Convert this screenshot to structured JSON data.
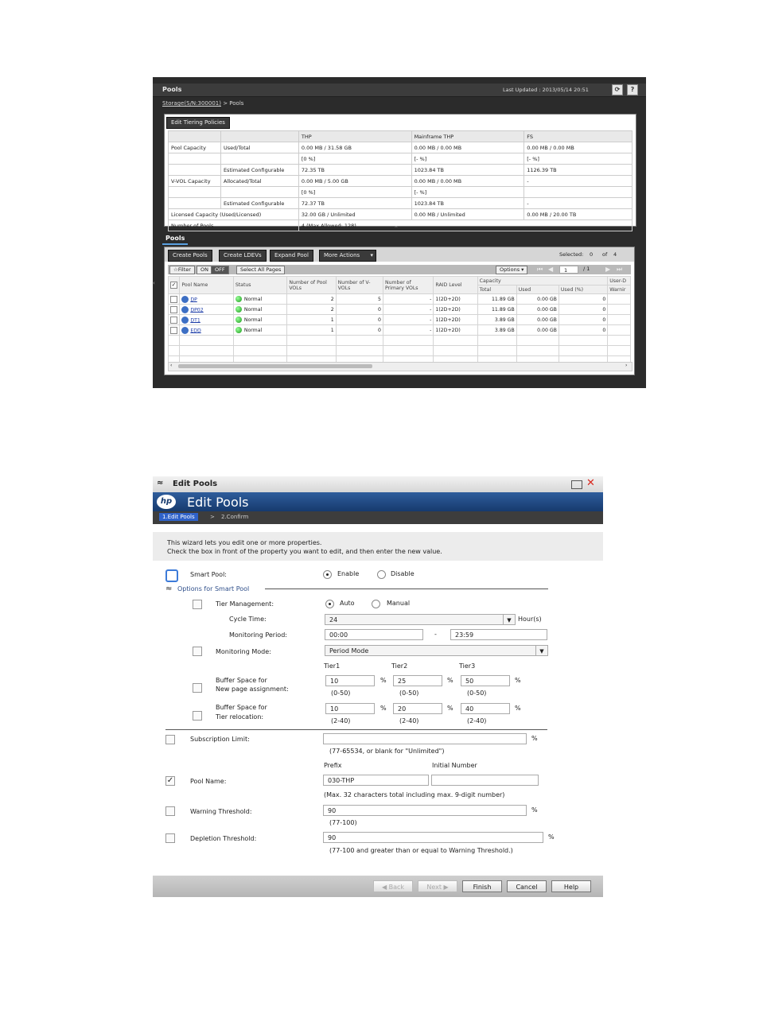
{
  "pools_screen": {
    "title": "Pools",
    "last_updated": "Last Updated : 2013/05/14 20:51",
    "refresh_icon": "refresh-icon",
    "help_icon": "help-icon",
    "help_label": "?",
    "breadcrumb_link": "Storage(S/N:300001)",
    "breadcrumb_rest": " > Pools",
    "edit_tiering_button": "Edit Tiering Policies",
    "summary": {
      "headers": [
        "",
        "",
        "THP",
        "Mainframe THP",
        "FS"
      ],
      "rows": [
        [
          "Pool Capacity",
          "Used/Total",
          "0.00 MB / 31.58 GB",
          "0.00 MB / 0.00 MB",
          "0.00 MB / 0.00 MB"
        ],
        [
          "",
          "",
          "[0 %]",
          "[- %]",
          "[- %]"
        ],
        [
          "",
          "Estimated Configurable",
          "72.35 TB",
          "1023.84 TB",
          "1126.39 TB"
        ],
        [
          "V-VOL Capacity",
          "Allocated/Total",
          "0.00 MB / 5.00 GB",
          "0.00 MB / 0.00 MB",
          "-"
        ],
        [
          "",
          "",
          "[0 %]",
          "[- %]",
          ""
        ],
        [
          "",
          "Estimated Configurable",
          "72.37 TB",
          "1023.84 TB",
          "-"
        ]
      ],
      "licensed_label": "Licensed Capacity (Used/Licensed)",
      "licensed_values": [
        "32.00 GB / Unlimited",
        "0.00 MB / Unlimited",
        "0.00 MB / 20.00 TB"
      ],
      "num_pools_label": "Number of Pools",
      "num_pools_value": "4 (Max Allowed: 128)"
    },
    "tab_label": "Pools",
    "buttons": [
      "Create Pools",
      "Create LDEVs",
      "Expand Pool",
      "More Actions"
    ],
    "selected_label": "Selected:",
    "selected_value": "0",
    "of_label": "of",
    "of_value": "4",
    "filter_label": "☆Filter",
    "on_label": "ON",
    "off_label": "OFF",
    "select_all_label": "Select All Pages",
    "options_label": "Options ▾",
    "page_value": "1",
    "page_total": "/ 1",
    "table_headers": {
      "pool_name": "Pool Name",
      "status": "Status",
      "pool_vols": "Number of Pool VOLs",
      "vvols": "Number of V-VOLs",
      "primary_vols": "Number of Primary VOLs",
      "raid": "RAID Level",
      "capacity": "Capacity",
      "total": "Total",
      "used": "Used",
      "used_pct": "Used (%)",
      "user_d": "User-D",
      "warning": "Warnir"
    },
    "rows": [
      {
        "name": "DP",
        "status": "Normal",
        "pool_vols": "2",
        "vvols": "5",
        "primary": "-",
        "raid": "1(2D+2D)",
        "total": "11.89 GB",
        "used": "0.00 GB",
        "pct": "0"
      },
      {
        "name": "DP02",
        "status": "Normal",
        "pool_vols": "2",
        "vvols": "0",
        "primary": "-",
        "raid": "1(2D+2D)",
        "total": "11.89 GB",
        "used": "0.00 GB",
        "pct": "0"
      },
      {
        "name": "DT1",
        "status": "Normal",
        "pool_vols": "1",
        "vvols": "0",
        "primary": "-",
        "raid": "1(2D+2D)",
        "total": "3.89 GB",
        "used": "0.00 GB",
        "pct": "0"
      },
      {
        "name": "EDD",
        "status": "Normal",
        "pool_vols": "1",
        "vvols": "0",
        "primary": "-",
        "raid": "1(2D+2D)",
        "total": "3.89 GB",
        "used": "0.00 GB",
        "pct": "0"
      }
    ]
  },
  "edit_pools": {
    "window_title": "Edit Pools",
    "banner_title": "Edit Pools",
    "logo_text": "hp",
    "steps": [
      "1.Edit Pools",
      ">",
      "2.Confirm"
    ],
    "intro_line1": "This wizard lets you edit one or more properties.",
    "intro_line2": "Check the  box in front of the property you want to edit, and then enter the new value.",
    "smart_pool_label": "Smart Pool:",
    "enable_label": "Enable",
    "disable_label": "Disable",
    "options_header": "Options for Smart Pool",
    "tier_mgmt_label": "Tier Management:",
    "auto_label": "Auto",
    "manual_label": "Manual",
    "cycle_time_label": "Cycle Time:",
    "cycle_time_value": "24",
    "hours_label": "Hour(s)",
    "monitoring_period_label": "Monitoring Period:",
    "period_from": "00:00",
    "period_dash": "-",
    "period_to": "23:59",
    "monitoring_mode_label": "Monitoring Mode:",
    "monitoring_mode_value": "Period Mode",
    "tier_headers": [
      "Tier1",
      "Tier2",
      "Tier3"
    ],
    "buffer_new_label1": "Buffer Space for",
    "buffer_new_label2": "New page assignment:",
    "buffer_new_values": [
      "10",
      "25",
      "50"
    ],
    "buffer_new_ranges": [
      "(0-50)",
      "(0-50)",
      "(0-50)"
    ],
    "buffer_reloc_label1": "Buffer Space for",
    "buffer_reloc_label2": "Tier relocation:",
    "buffer_reloc_values": [
      "10",
      "20",
      "40"
    ],
    "buffer_reloc_ranges": [
      "(2-40)",
      "(2-40)",
      "(2-40)"
    ],
    "percent": "%",
    "subscription_label": "Subscription Limit:",
    "subscription_value": "",
    "subscription_hint": "(77-65534, or blank for \"Unlimited\")",
    "prefix_label": "Prefix",
    "initial_number_label": "Initial Number",
    "pool_name_label": "Pool Name:",
    "pool_name_value": "030-THP",
    "initial_number_value": "",
    "pool_name_hint": "(Max. 32 characters total including max. 9-digit number)",
    "warning_label": "Warning Threshold:",
    "warning_value": "90",
    "warning_hint": "(77-100)",
    "depletion_label": "Depletion Threshold:",
    "depletion_value": "90",
    "depletion_hint": "(77-100 and greater than or equal to Warning Threshold.)",
    "footer_buttons": {
      "back": "◀ Back",
      "next": "Next ▶",
      "finish": "Finish",
      "cancel": "Cancel",
      "help": "Help"
    },
    "colors": {
      "banner": "#173a6d",
      "step_active": "#2f62c9",
      "close": "#d9261c"
    }
  }
}
